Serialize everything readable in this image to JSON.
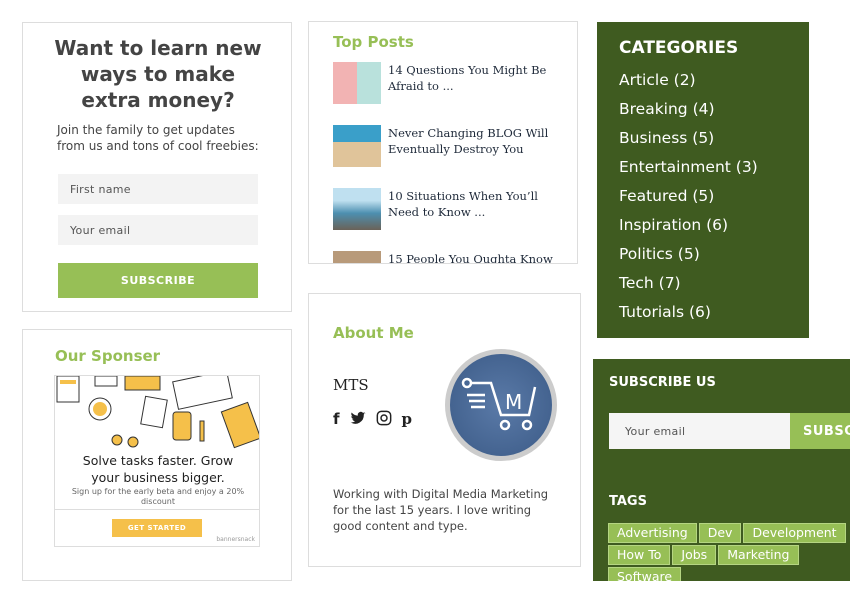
{
  "newsletter": {
    "title": "Want to learn new ways to make extra money?",
    "subtitle": "Join the family to get updates from us and tons of cool freebies:",
    "first_name_placeholder": "First name",
    "email_placeholder": "Your email",
    "subscribe_label": "SUBSCRIBE"
  },
  "sponsor": {
    "title": "Our Sponser",
    "headline": "Solve tasks faster. Grow your business bigger.",
    "subtext": "Sign up for the early beta and enjoy a 20% discount",
    "cta": "GET STARTED",
    "brand": "bannersnack"
  },
  "top_posts": {
    "title": "Top Posts",
    "items": [
      {
        "title": "14 Questions You Might Be Afraid to ..."
      },
      {
        "title": "Never Changing BLOG Will Eventually Destroy You"
      },
      {
        "title": "10 Situations When You’ll Need to Know ..."
      },
      {
        "title": "15 People You Oughta Know"
      }
    ]
  },
  "about": {
    "title": "About Me",
    "name": "MTS",
    "description": "Working with Digital Media Marketing for the last 15 years. I love writing good content and type.",
    "logo_letter": "M",
    "social": [
      "facebook-icon",
      "twitter-icon",
      "instagram-icon",
      "pinterest-icon"
    ]
  },
  "categories": {
    "title": "CATEGORIES",
    "items": [
      "Article (2)",
      "Breaking (4)",
      "Business (5)",
      "Entertainment (3)",
      "Featured (5)",
      "Inspiration (6)",
      "Politics (5)",
      "Tech (7)",
      "Tutorials (6)"
    ]
  },
  "subscribe": {
    "title": "SUBSCRIBE US",
    "email_placeholder": "Your email",
    "button_label": "SUBSCRIBE"
  },
  "tags": {
    "title": "TAGS",
    "items": [
      "Advertising",
      "Dev",
      "Development",
      "How To",
      "Jobs",
      "Marketing",
      "Software"
    ]
  },
  "colors": {
    "accent": "#97bf56",
    "dark_green": "#3f5b20"
  }
}
